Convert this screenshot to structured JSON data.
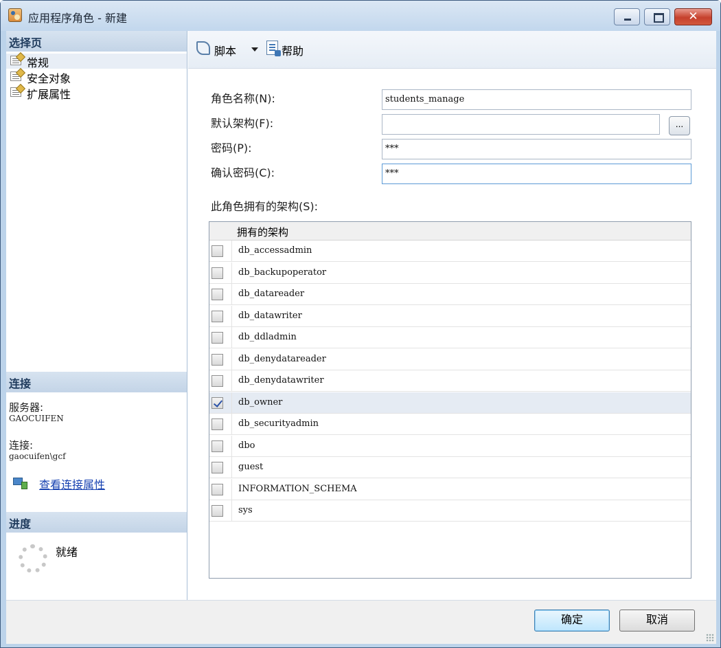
{
  "window": {
    "title": "应用程序角色 - 新建",
    "close_glyph": "✕"
  },
  "left": {
    "pages_header": "选择页",
    "pages": [
      {
        "label": "常规",
        "icon": "page-icon"
      },
      {
        "label": "安全对象",
        "icon": "page-icon"
      },
      {
        "label": "扩展属性",
        "icon": "page-icon"
      }
    ],
    "connection_header": "连接",
    "server_label": "服务器:",
    "server_value": "GAOCUIFEN",
    "conn_label": "连接:",
    "conn_value": "gaocuifen\\gcf",
    "conn_link": "查看连接属性",
    "progress_header": "进度",
    "progress_status": "就绪"
  },
  "toolbar": {
    "script_label": "脚本",
    "help_label": "帮助"
  },
  "form": {
    "role_name_label": "角色名称(N):",
    "role_name_value": "students_manage",
    "default_schema_label": "默认架构(F):",
    "default_schema_value": "",
    "browse_label": "...",
    "password_label": "密码(P):",
    "password_value": "***",
    "confirm_label": "确认密码(C):",
    "confirm_value": "***",
    "schemas_label": "此角色拥有的架构(S):"
  },
  "schemas": {
    "column_header": "拥有的架构",
    "rows": [
      {
        "name": "db_accessadmin",
        "checked": false
      },
      {
        "name": "db_backupoperator",
        "checked": false
      },
      {
        "name": "db_datareader",
        "checked": false
      },
      {
        "name": "db_datawriter",
        "checked": false
      },
      {
        "name": "db_ddladmin",
        "checked": false
      },
      {
        "name": "db_denydatareader",
        "checked": false
      },
      {
        "name": "db_denydatawriter",
        "checked": false
      },
      {
        "name": "db_owner",
        "checked": true
      },
      {
        "name": "db_securityadmin",
        "checked": false
      },
      {
        "name": "dbo",
        "checked": false
      },
      {
        "name": "guest",
        "checked": false
      },
      {
        "name": "INFORMATION_SCHEMA",
        "checked": false
      },
      {
        "name": "sys",
        "checked": false
      }
    ]
  },
  "buttons": {
    "ok": "确定",
    "cancel": "取消"
  },
  "colors": {
    "link": "#1540b0",
    "header_bg": "#c3d4e7",
    "selected_row": "#e5ebf3"
  }
}
